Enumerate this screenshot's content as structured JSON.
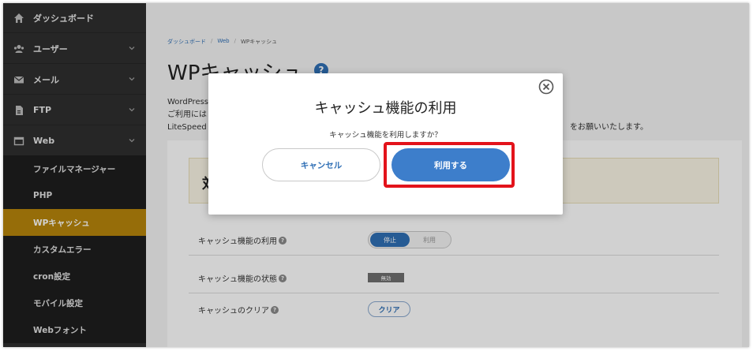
{
  "sidebar": {
    "dashboard": "ダッシュボード",
    "user": "ユーザー",
    "mail": "メール",
    "ftp": "FTP",
    "web": "Web",
    "web_sub": [
      "ファイルマネージャー",
      "PHP",
      "WPキャッシュ",
      "カスタムエラー",
      "cron設定",
      "モバイル設定",
      "Webフォント"
    ],
    "active_sub": "WPキャッシュ"
  },
  "breadcrumb": [
    "ダッシュボード",
    "Web",
    "WPキャッシュ"
  ],
  "page": {
    "title": "WPキャッシュ",
    "help": "?",
    "desc_line1": "WordPress",
    "desc_line2": "ご利用には",
    "desc_line3": "LiteSpeed",
    "desc_tail": "をお願いいたします。",
    "notice_glyph": "対"
  },
  "settings": {
    "cache_usage_label": "キャッシュ機能の利用",
    "toggle_on": "停止",
    "toggle_off": "利用",
    "cache_status_label": "キャッシュ機能の状態",
    "cache_status_value": "無効",
    "cache_clear_label": "キャッシュのクリア",
    "clear_button": "クリア"
  },
  "modal": {
    "title": "キャッシュ機能の利用",
    "message": "キャッシュ機能を利用しますか？",
    "cancel": "キャンセル",
    "confirm": "利用する"
  },
  "colors": {
    "sidebar_bg": "#2f2f2f",
    "active_item": "#b8860b",
    "primary": "#3d7ecb",
    "highlight": "#e3131b"
  }
}
